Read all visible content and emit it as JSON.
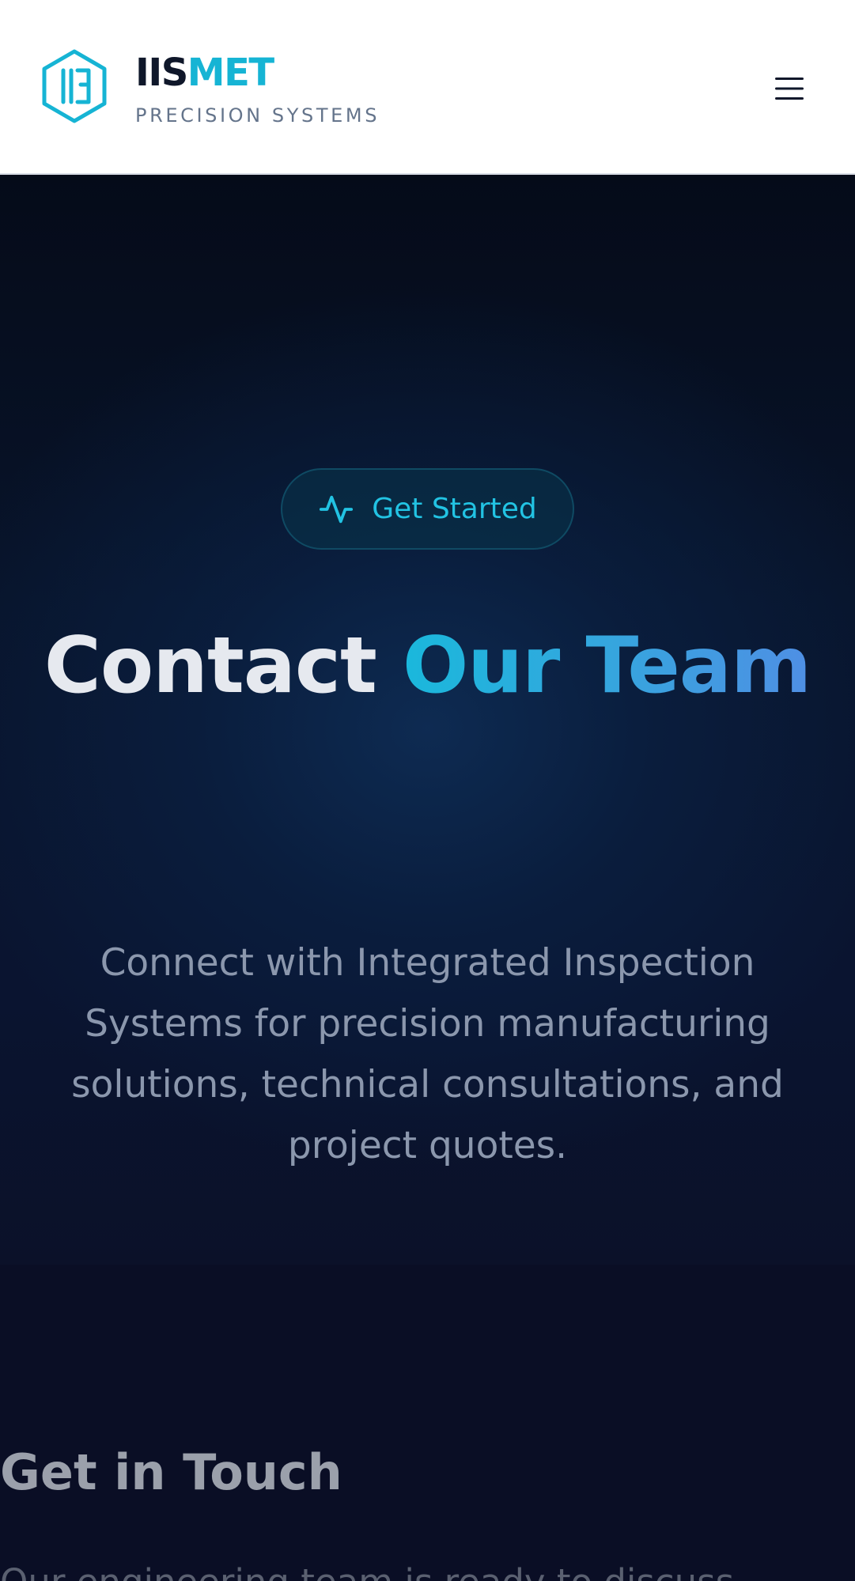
{
  "header": {
    "logo_icon": "hexagon-iis-logo-icon",
    "brand_part1": "IIS",
    "brand_part2": "MET",
    "tagline": "PRECISION SYSTEMS",
    "menu_icon": "hamburger-menu-icon",
    "menu_glyph": "☰"
  },
  "hero": {
    "pill_icon": "activity-pulse-icon",
    "pill_label": "Get Started",
    "title_part1": "Contact ",
    "title_part2": "Our Team",
    "description": "Connect with Integrated Inspection Systems for precision manufacturing solutions, technical consultations, and project quotes."
  },
  "contact": {
    "title": "Get in Touch",
    "intro": "Our engineering team is ready to discuss"
  },
  "colors": {
    "accent": "#16b4d4",
    "brand_dark": "#0f172a",
    "hero_bg": "#0a1430",
    "section_bg": "#0a0e25"
  }
}
